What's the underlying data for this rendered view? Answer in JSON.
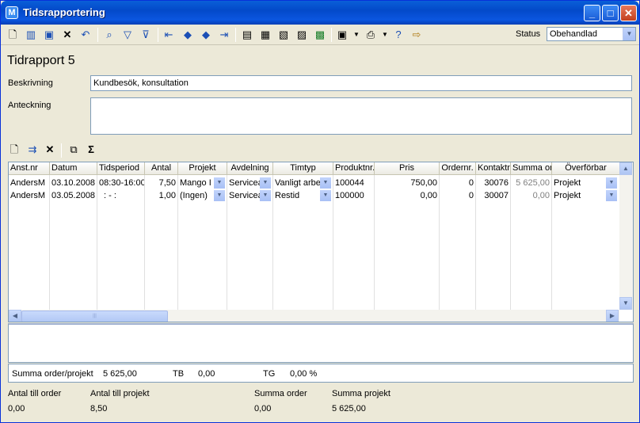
{
  "window": {
    "title": "Tidsrapportering",
    "app_letter": "M"
  },
  "toolbar": {
    "status_label": "Status",
    "status_value": "Obehandlad"
  },
  "form": {
    "heading": "Tidrapport 5",
    "beskrivning_label": "Beskrivning",
    "beskrivning_value": "Kundbesök, konsultation",
    "anteckning_label": "Anteckning",
    "anteckning_value": ""
  },
  "grid": {
    "columns": [
      "Anst.nr",
      "Datum",
      "Tidsperiod",
      "Antal",
      "Projekt",
      "Avdelning",
      "Timtyp",
      "Produktnr.",
      "Pris",
      "Ordernr.",
      "Kontaktnr",
      "Summa ord",
      "Överförbar"
    ],
    "rows": [
      {
        "anstnr": "AndersM",
        "datum": "03.10.2008",
        "tidsperiod": "08:30-16:00",
        "antal": "7,50",
        "projekt": "Mango I",
        "avdelning": "Servicea",
        "timtyp": "Vanligt arbe",
        "produktnr": "100044",
        "pris": "750,00",
        "ordernr": "0",
        "kontaktnr": "30076",
        "summa": "5 625,00",
        "overforbar": "Projekt"
      },
      {
        "anstnr": "AndersM",
        "datum": "03.05.2008",
        "tidsperiod": ": - :",
        "antal": "1,00",
        "projekt": "(Ingen)",
        "avdelning": "Servicea",
        "timtyp": "Restid",
        "produktnr": "100000",
        "pris": "0,00",
        "ordernr": "0",
        "kontaktnr": "30007",
        "summa": "0,00",
        "overforbar": "Projekt"
      }
    ]
  },
  "summary": {
    "order_projekt_label": "Summa order/projekt",
    "order_projekt_value": "5 625,00",
    "tb_label": "TB",
    "tb_value": "0,00",
    "tg_label": "TG",
    "tg_value": "0,00 %"
  },
  "footer": {
    "antal_order_label": "Antal till order",
    "antal_order_value": "0,00",
    "antal_projekt_label": "Antal till projekt",
    "antal_projekt_value": "8,50",
    "summa_order_label": "Summa order",
    "summa_order_value": "0,00",
    "summa_projekt_label": "Summa projekt",
    "summa_projekt_value": "5 625,00"
  }
}
